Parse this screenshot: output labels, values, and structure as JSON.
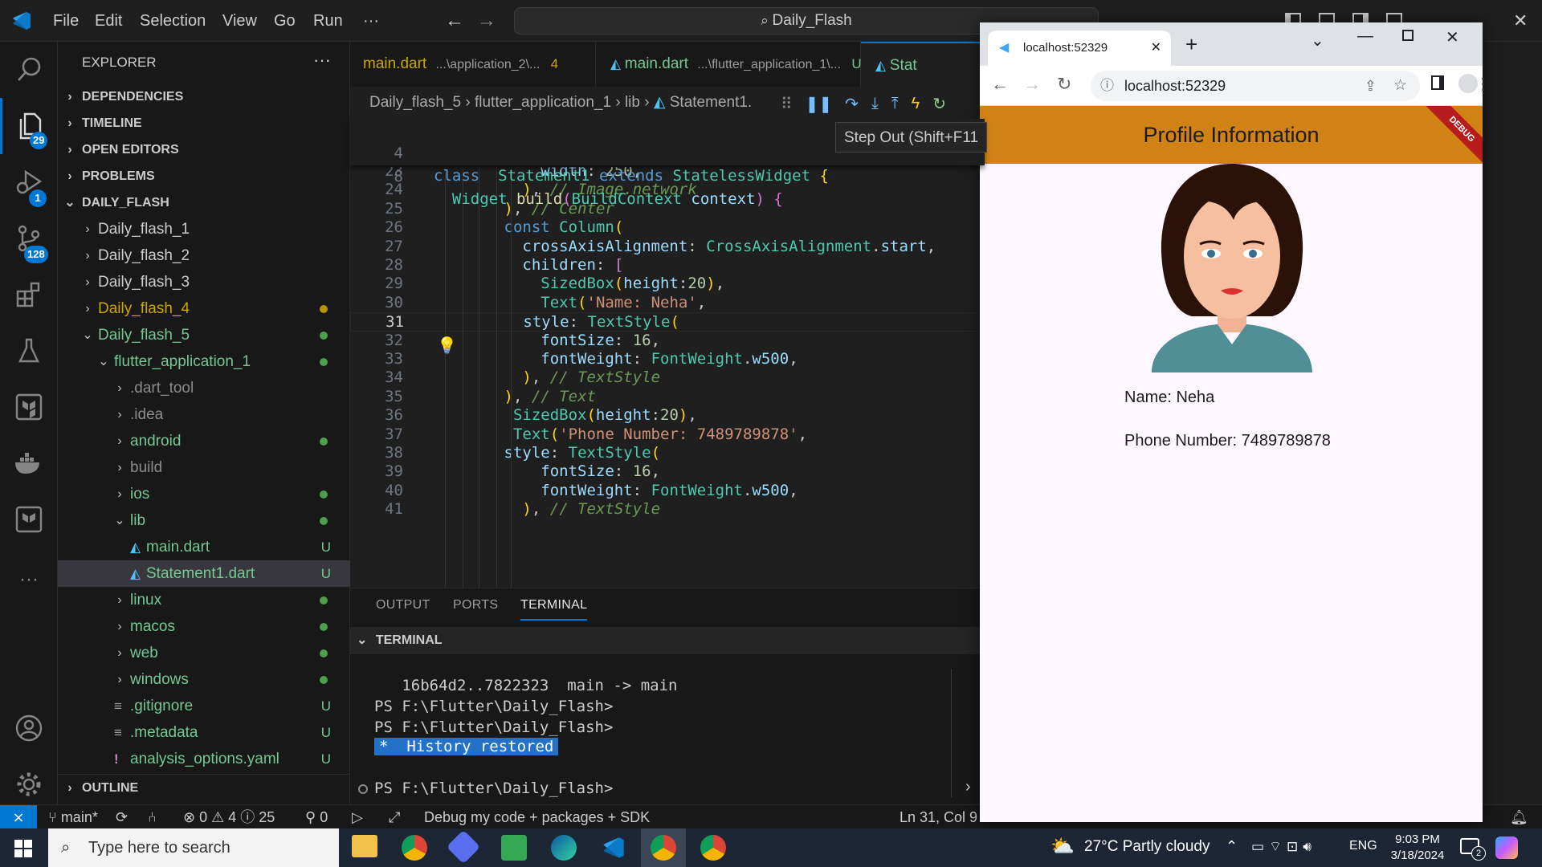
{
  "titlebar": {
    "menu": [
      "File",
      "Edit",
      "Selection",
      "View",
      "Go",
      "Run",
      "···"
    ],
    "search": "Daily_Flash"
  },
  "activity": {
    "badges": {
      "explorer": "29",
      "debug": "1",
      "scm": "128"
    }
  },
  "sidebar": {
    "header": "EXPLORER",
    "more": "···",
    "sections": {
      "dependencies": "DEPENDENCIES",
      "timeline": "TIMELINE",
      "open_editors": "OPEN EDITORS",
      "problems": "PROBLEMS",
      "workspace": "DAILY_FLASH",
      "outline": "OUTLINE"
    },
    "items": [
      {
        "label": "Daily_flash_1",
        "indent": 1,
        "chev": "›",
        "color": "#cccccc",
        "mark": ""
      },
      {
        "label": "Daily_flash_2",
        "indent": 1,
        "chev": "›",
        "color": "#cccccc",
        "mark": ""
      },
      {
        "label": "Daily_flash_3",
        "indent": 1,
        "chev": "›",
        "color": "#cccccc",
        "mark": ""
      },
      {
        "label": "Daily_flash_4",
        "indent": 1,
        "chev": "›",
        "color": "#cca700",
        "mark": "dot-yellow"
      },
      {
        "label": "Daily_flash_5",
        "indent": 1,
        "chev": "⌄",
        "color": "#73c991",
        "mark": "dot-green"
      },
      {
        "label": "flutter_application_1",
        "indent": 2,
        "chev": "⌄",
        "color": "#73c991",
        "mark": "dot-green"
      },
      {
        "label": ".dart_tool",
        "indent": 3,
        "chev": "›",
        "color": "#8c8c8c",
        "mark": ""
      },
      {
        "label": ".idea",
        "indent": 3,
        "chev": "›",
        "color": "#8c8c8c",
        "mark": ""
      },
      {
        "label": "android",
        "indent": 3,
        "chev": "›",
        "color": "#73c991",
        "mark": "dot-green"
      },
      {
        "label": "build",
        "indent": 3,
        "chev": "›",
        "color": "#8c8c8c",
        "mark": ""
      },
      {
        "label": "ios",
        "indent": 3,
        "chev": "›",
        "color": "#73c991",
        "mark": "dot-green"
      },
      {
        "label": "lib",
        "indent": 3,
        "chev": "⌄",
        "color": "#73c991",
        "mark": "dot-green"
      },
      {
        "label": "main.dart",
        "indent": 4,
        "chev": "",
        "color": "#73c991",
        "mark": "U",
        "icon": "dart"
      },
      {
        "label": "Statement1.dart",
        "indent": 4,
        "chev": "",
        "color": "#73c991",
        "mark": "U",
        "icon": "dart",
        "selected": true
      },
      {
        "label": "linux",
        "indent": 3,
        "chev": "›",
        "color": "#73c991",
        "mark": "dot-green"
      },
      {
        "label": "macos",
        "indent": 3,
        "chev": "›",
        "color": "#73c991",
        "mark": "dot-green"
      },
      {
        "label": "web",
        "indent": 3,
        "chev": "›",
        "color": "#73c991",
        "mark": "dot-green"
      },
      {
        "label": "windows",
        "indent": 3,
        "chev": "›",
        "color": "#73c991",
        "mark": "dot-green"
      },
      {
        "label": ".gitignore",
        "indent": 3,
        "chev": "",
        "color": "#73c991",
        "mark": "U",
        "icon": "lines"
      },
      {
        "label": ".metadata",
        "indent": 3,
        "chev": "",
        "color": "#73c991",
        "mark": "U",
        "icon": "lines"
      },
      {
        "label": "analysis_options.yaml",
        "indent": 3,
        "chev": "",
        "color": "#73c991",
        "mark": "U",
        "icon": "excl"
      }
    ]
  },
  "editor": {
    "tabs": [
      {
        "name": "main.dart",
        "path": "...\\application_2\\...",
        "badge": "4",
        "name_color": "#cca700",
        "badge_color": "#cca700"
      },
      {
        "name": "main.dart",
        "path": "...\\flutter_application_1\\...",
        "badge": "U",
        "name_color": "#73c991",
        "badge_color": "#73c991"
      },
      {
        "name": "Stat",
        "path": "",
        "badge": "",
        "name_color": "#73c991",
        "badge_color": "#73c991"
      }
    ],
    "breadcrumb": [
      "Daily_flash_5",
      "flutter_application_1",
      "lib",
      "Statement1."
    ],
    "tooltip": "Step Out (Shift+F11",
    "sticky": [
      {
        "ln": "4",
        "code": "class  Statement1 extends StatelessWidget {"
      },
      {
        "ln": "8",
        "code": "  Widget build(BuildContext context) {"
      }
    ],
    "lines": [
      {
        "ln": "23",
        "text": "            width: 250,"
      },
      {
        "ln": "24",
        "text": "          ), // Image.network"
      },
      {
        "ln": "25",
        "text": "        ), // Center"
      },
      {
        "ln": "26",
        "text": "        const Column("
      },
      {
        "ln": "27",
        "text": "          crossAxisAlignment: CrossAxisAlignment.start,"
      },
      {
        "ln": "28",
        "text": "          children: ["
      },
      {
        "ln": "29",
        "text": "            SizedBox(height:20),"
      },
      {
        "ln": "30",
        "text": "            Text('Name: Neha',"
      },
      {
        "ln": "31",
        "text": "          style: TextStyle("
      },
      {
        "ln": "32",
        "text": "            fontSize: 16,"
      },
      {
        "ln": "33",
        "text": "            fontWeight: FontWeight.w500,"
      },
      {
        "ln": "34",
        "text": "          ), // TextStyle"
      },
      {
        "ln": "35",
        "text": "        ), // Text"
      },
      {
        "ln": "36",
        "text": "         SizedBox(height:20),"
      },
      {
        "ln": "37",
        "text": "         Text('Phone Number: 7489789878',"
      },
      {
        "ln": "38",
        "text": "        style: TextStyle("
      },
      {
        "ln": "39",
        "text": "            fontSize: 16,"
      },
      {
        "ln": "40",
        "text": "            fontWeight: FontWeight.w500,"
      },
      {
        "ln": "41",
        "text": "          ), // TextStyle"
      }
    ],
    "current_line": "31"
  },
  "panel": {
    "tabs": [
      "OUTPUT",
      "PORTS",
      "TERMINAL"
    ],
    "active_tab": "TERMINAL",
    "section": "TERMINAL",
    "lines": [
      "   16b64d2..7822323  main -> main",
      "PS F:\\Flutter\\Daily_Flash>",
      "PS F:\\Flutter\\Daily_Flash>"
    ],
    "restored_star": "*",
    "restored": "History restored",
    "prompt": "PS F:\\Flutter\\Daily_Flash>"
  },
  "statusbar": {
    "branch": "main*",
    "errors": "0",
    "warnings": "4",
    "infos": "25",
    "ports": "0",
    "debug": "Debug my code + packages + SDK",
    "position": "Ln 31, Col 9"
  },
  "browser": {
    "tab_title": "localhost:52329",
    "url": "localhost:52329",
    "app": {
      "title": "Profile Information",
      "debug": "DEBUG",
      "name": "Name: Neha",
      "phone": "Phone Number: 7489789878"
    }
  },
  "taskbar": {
    "search_placeholder": "Type here to search",
    "weather": "27°C  Partly cloudy",
    "lang": "ENG",
    "time": "9:03 PM",
    "date": "3/18/2024",
    "notifications": "2"
  },
  "colors": {
    "accent": "#0078d4",
    "appbar": "#d18215",
    "git_added": "#73c991",
    "git_modified": "#cca700"
  }
}
